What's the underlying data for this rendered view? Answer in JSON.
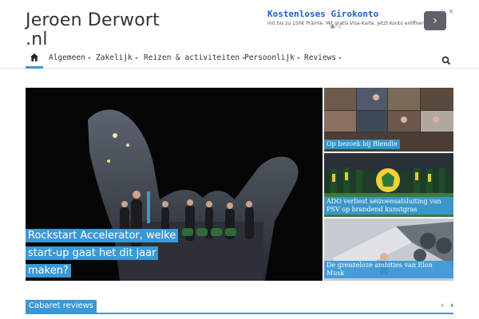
{
  "site": {
    "title": "Jeroen Derwort .nl",
    "accent": "#3b98d6"
  },
  "ad": {
    "title": "Kostenloses Girokonto",
    "subtitle": "mit bis zu 150€ Prämie. Mit gratis Visa-Karte. Jetzt Konto eröffnen!",
    "arrow_icon": "chevron-right-icon",
    "close_icon": "close-icon"
  },
  "nav": {
    "home_icon": "home-icon",
    "items": [
      {
        "label": "Algemeen"
      },
      {
        "label": "Zakelijk"
      },
      {
        "label": "Reizen & activiteiten"
      },
      {
        "label": "Persoonlijk"
      },
      {
        "label": "Reviews"
      }
    ],
    "search_icon": "search-icon"
  },
  "featured": {
    "main": {
      "caption_lines": [
        "Rockstart Accelerator, welke",
        "start-up gaat het dit jaar",
        "maken?"
      ]
    },
    "side": [
      {
        "caption": "Op bezoek bij Blendle"
      },
      {
        "caption": "ADO verliest seizoensafsluiting van PSV op brandend kunstgras"
      },
      {
        "caption": "De grenzeloze ambities van Elon Musk"
      }
    ]
  },
  "section": {
    "label": "Cabaret reviews",
    "prev_icon": "chevron-left-icon",
    "next_icon": "chevron-right-icon"
  }
}
